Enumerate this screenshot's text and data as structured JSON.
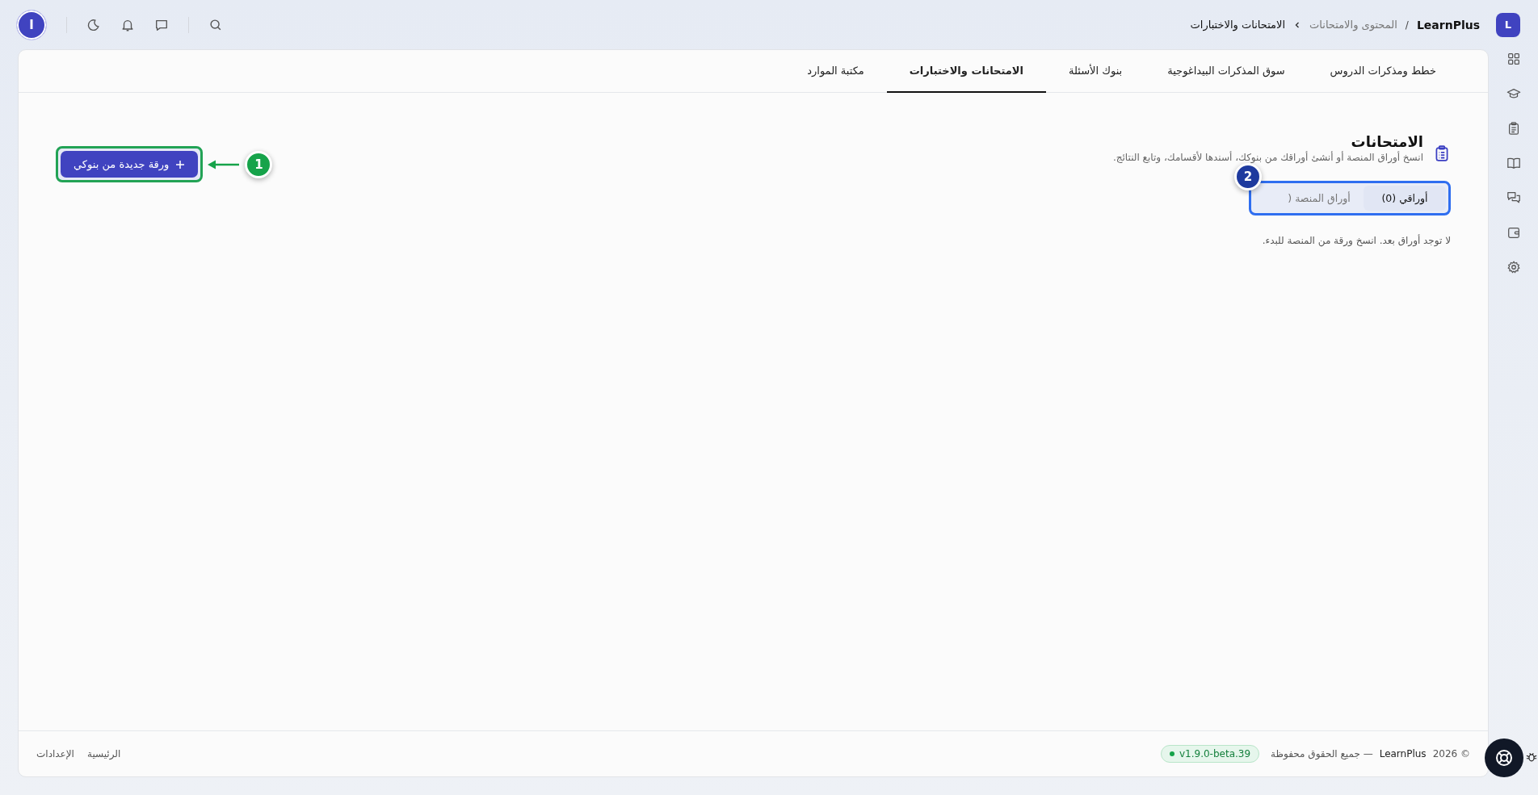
{
  "topbar": {
    "logo_letter": "L",
    "brand": "LearnPlus",
    "separator": "/",
    "breadcrumb": [
      {
        "label": "المحتوى والامتحانات",
        "current": false
      },
      {
        "label": "الامتحانات والاختبارات",
        "current": true
      }
    ],
    "avatar_letter": "ا"
  },
  "tabs": [
    {
      "label": "خطط ومذكرات الدروس",
      "selected": false
    },
    {
      "label": "سوق المذكرات البيداغوجية",
      "selected": false
    },
    {
      "label": "بنوك الأسئلة",
      "selected": false
    },
    {
      "label": "الامتحانات والاختبارات",
      "selected": true
    },
    {
      "label": "مكتبة الموارد",
      "selected": false
    }
  ],
  "page": {
    "title": "الامتحانات",
    "subtitle": "انسخ أوراق المنصة أو أنشئ أوراقك من بنوكك، أسندها لأقسامك، وتابع النتائج.",
    "new_button": {
      "label": "ورقة جديدة من بنوكي",
      "annotation": "1"
    },
    "segments_annotation": "2",
    "segments": [
      {
        "label": "أوراقي (0)",
        "selected": true
      },
      {
        "label": "أوراق المنصة (",
        "selected": false
      }
    ],
    "empty_message": "لا توجد أوراق بعد. انسخ ورقة من المنصة للبدء."
  },
  "footer": {
    "copyright": "© 2026",
    "brand": "LearnPlus",
    "rights": "— جميع الحقوق محفوظة",
    "version": "v1.9.0-beta.39",
    "links": [
      "الرئيسية",
      "الإعدادات"
    ]
  }
}
